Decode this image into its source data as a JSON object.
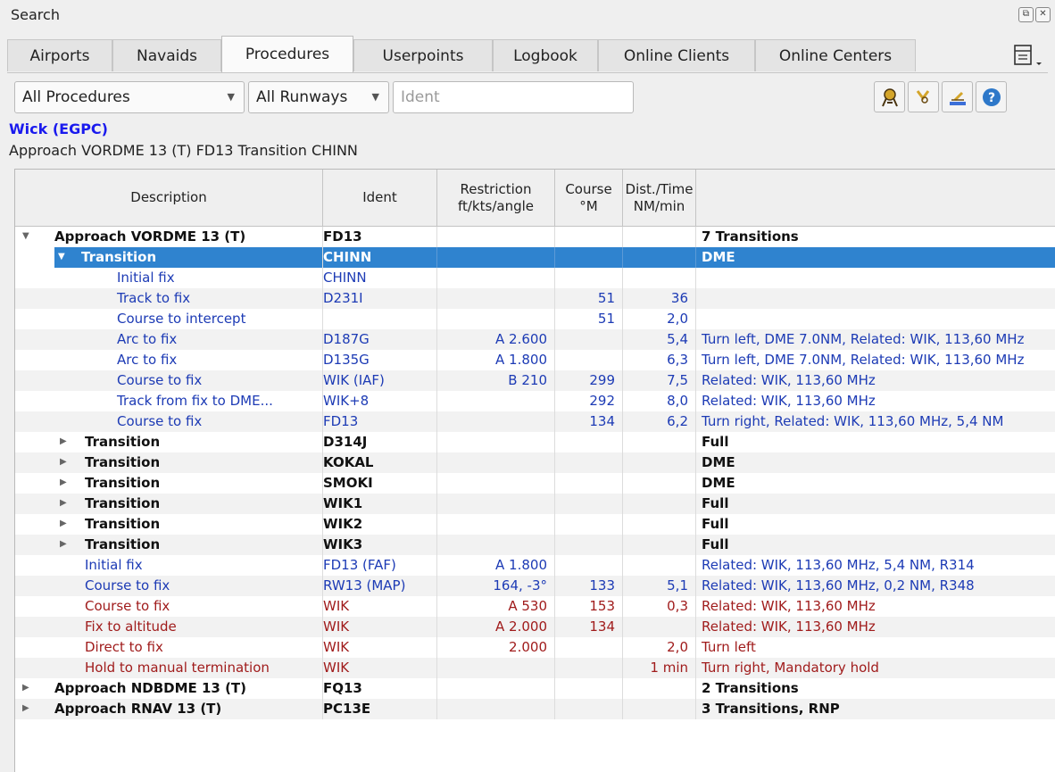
{
  "window": {
    "title": "Search"
  },
  "tabs": [
    "Airports",
    "Navaids",
    "Procedures",
    "Userpoints",
    "Logbook",
    "Online Clients",
    "Online Centers"
  ],
  "filters": {
    "procedure_type": "All Procedures",
    "runway": "All Runways",
    "ident_placeholder": "Ident"
  },
  "airport": "Wick (EGPC)",
  "selection_label": "Approach VORDME 13 (T) FD13 Transition CHINN",
  "columns": {
    "description": "Description",
    "ident": "Ident",
    "restriction_1": "Restriction",
    "restriction_2": "ft/kts/angle",
    "course_1": "Course",
    "course_2": "°M",
    "dist_1": "Dist./Time",
    "dist_2": "NM/min",
    "remarks": ""
  },
  "rows": [
    {
      "description": "Approach VORDME 13 (T)",
      "ident": "FD13",
      "restriction": "",
      "course": "",
      "dist": "",
      "remarks": "7 Transitions"
    },
    {
      "description": "Transition",
      "ident": "CHINN",
      "restriction": "",
      "course": "",
      "dist": "",
      "remarks": "DME"
    },
    {
      "description": "Initial fix",
      "ident": "CHINN",
      "restriction": "",
      "course": "",
      "dist": "",
      "remarks": ""
    },
    {
      "description": "Track to fix",
      "ident": "D231I",
      "restriction": "",
      "course": "51",
      "dist": "36",
      "remarks": ""
    },
    {
      "description": "Course to intercept",
      "ident": "",
      "restriction": "",
      "course": "51",
      "dist": "2,0",
      "remarks": ""
    },
    {
      "description": "Arc to fix",
      "ident": "D187G",
      "restriction": "A 2.600",
      "course": "",
      "dist": "5,4",
      "remarks": "Turn left, DME 7.0NM, Related: WIK, 113,60 MHz"
    },
    {
      "description": "Arc to fix",
      "ident": "D135G",
      "restriction": "A 1.800",
      "course": "",
      "dist": "6,3",
      "remarks": "Turn left, DME 7.0NM, Related: WIK, 113,60 MHz"
    },
    {
      "description": "Course to fix",
      "ident": "WIK (IAF)",
      "restriction": "B 210",
      "course": "299",
      "dist": "7,5",
      "remarks": "Related: WIK, 113,60 MHz"
    },
    {
      "description": "Track from fix to DME...",
      "ident": "WIK+8",
      "restriction": "",
      "course": "292",
      "dist": "8,0",
      "remarks": "Related: WIK, 113,60 MHz"
    },
    {
      "description": "Course to fix",
      "ident": "FD13",
      "restriction": "",
      "course": "134",
      "dist": "6,2",
      "remarks": "Turn right, Related: WIK, 113,60 MHz, 5,4 NM"
    },
    {
      "description": "Transition",
      "ident": "D314J",
      "restriction": "",
      "course": "",
      "dist": "",
      "remarks": "Full"
    },
    {
      "description": "Transition",
      "ident": "KOKAL",
      "restriction": "",
      "course": "",
      "dist": "",
      "remarks": "DME"
    },
    {
      "description": "Transition",
      "ident": "SMOKI",
      "restriction": "",
      "course": "",
      "dist": "",
      "remarks": "DME"
    },
    {
      "description": "Transition",
      "ident": "WIK1",
      "restriction": "",
      "course": "",
      "dist": "",
      "remarks": "Full"
    },
    {
      "description": "Transition",
      "ident": "WIK2",
      "restriction": "",
      "course": "",
      "dist": "",
      "remarks": "Full"
    },
    {
      "description": "Transition",
      "ident": "WIK3",
      "restriction": "",
      "course": "",
      "dist": "",
      "remarks": "Full"
    },
    {
      "description": "Initial fix",
      "ident": "FD13 (FAF)",
      "restriction": "A 1.800",
      "course": "",
      "dist": "",
      "remarks": "Related: WIK, 113,60 MHz, 5,4 NM, R314"
    },
    {
      "description": "Course to fix",
      "ident": "RW13 (MAP)",
      "restriction": "164, -3°",
      "course": "133",
      "dist": "5,1",
      "remarks": "Related: WIK, 113,60 MHz, 0,2 NM, R348"
    },
    {
      "description": "Course to fix",
      "ident": "WIK",
      "restriction": "A 530",
      "course": "153",
      "dist": "0,3",
      "remarks": "Related: WIK, 113,60 MHz"
    },
    {
      "description": "Fix to altitude",
      "ident": "WIK",
      "restriction": "A 2.000",
      "course": "134",
      "dist": "",
      "remarks": "Related: WIK, 113,60 MHz"
    },
    {
      "description": "Direct to fix",
      "ident": "WIK",
      "restriction": "2.000",
      "course": "",
      "dist": "2,0",
      "remarks": "Turn left"
    },
    {
      "description": "Hold to manual termination",
      "ident": "WIK",
      "restriction": "",
      "course": "",
      "dist": "1 min",
      "remarks": "Turn right, Mandatory hold"
    },
    {
      "description": "Approach NDBDME 13 (T)",
      "ident": "FQ13",
      "restriction": "",
      "course": "",
      "dist": "",
      "remarks": "2 Transitions"
    },
    {
      "description": "Approach RNAV 13 (T)",
      "ident": "PC13E",
      "restriction": "",
      "course": "",
      "dist": "",
      "remarks": "3 Transitions, RNP"
    }
  ],
  "colors": {
    "selection": "#2f83cf",
    "airport_link": "#1a1aee",
    "leg_blue": "#1d3bb5",
    "missed_red": "#a01c1c"
  }
}
